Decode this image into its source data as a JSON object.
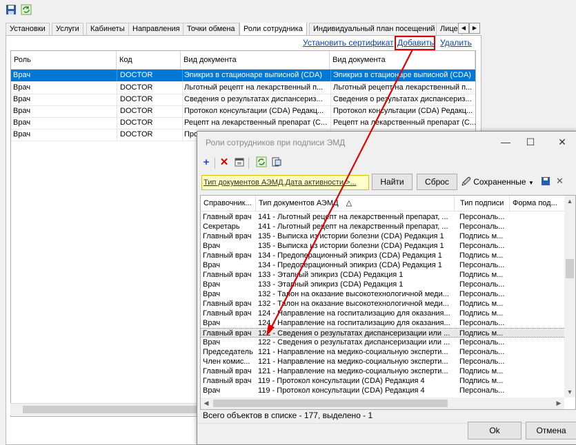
{
  "toolbar": {
    "save_icon": "save-icon",
    "refresh_icon": "refresh-icon"
  },
  "tabs": [
    "Установки",
    "Услуги",
    "Кабинеты",
    "Направления",
    "Точки обмена",
    "Роли сотрудника",
    "Индивидуальный план посещений",
    "Лице"
  ],
  "active_tab_index": 5,
  "actions": {
    "install_cert": "Установить сертификат",
    "add": "Добавить",
    "delete": "Удалить"
  },
  "main_grid": {
    "columns": [
      "Роль",
      "Код",
      "Вид документа",
      "Вид документа"
    ],
    "rows": [
      [
        "Врач",
        "DOCTOR",
        "Эпикриз в стационаре выписной (CDA)",
        "Эпикриз в стационаре выписной (CDA)"
      ],
      [
        "Врач",
        "DOCTOR",
        "Льготный рецепт на лекарственный п...",
        "Льготный рецепт на лекарственный п..."
      ],
      [
        "Врач",
        "DOCTOR",
        "Сведения о результатах диспансериз...",
        "Сведения о результатах диспансериз..."
      ],
      [
        "Врач",
        "DOCTOR",
        "Протокол консультации (CDA) Редакц...",
        "Протокол консультации (CDA) Редакц..."
      ],
      [
        "Врач",
        "DOCTOR",
        "Рецепт на лекарственный препарат (С...",
        "Рецепт на лекарственный препарат (С..."
      ],
      [
        "Врач",
        "DOCTOR",
        "Про",
        ""
      ]
    ],
    "selected_row": 0
  },
  "dialog": {
    "title": "Роли сотрудников при подписи ЭМД",
    "window_controls": {
      "minimize": "—",
      "maximize": "☐",
      "close": "✕"
    },
    "tool_icons": [
      "add-icon",
      "delete-icon",
      "properties-icon",
      "refresh-icon",
      "export-icon"
    ],
    "filter_text": "Тип документов АЭМД.Дата активности >...",
    "find_label": "Найти",
    "reset_label": "Сброс",
    "saved_label": "Сохраненные",
    "columns": [
      "Справочник...",
      "Тип документов АЭМД",
      "Тип подписи",
      "Форма под..."
    ],
    "sort_indicator": "△",
    "rows": [
      [
        "Главный врач",
        "141 - Льготный рецепт на лекарственный препарат, ...",
        "Персональ..."
      ],
      [
        "Секретарь",
        "141 - Льготный рецепт на лекарственный препарат, ...",
        "Персональ..."
      ],
      [
        "Главный врач",
        "135 - Выписка из истории болезни (CDA) Редакция 1",
        "Подпись м..."
      ],
      [
        "Врач",
        "135 - Выписка из истории болезни (CDA) Редакция 1",
        "Персональ..."
      ],
      [
        "Главный врач",
        "134 - Предоперационный эпикриз (CDA) Редакция 1",
        "Подпись м..."
      ],
      [
        "Врач",
        "134 - Предоперационный эпикриз (CDA) Редакция 1",
        "Персональ..."
      ],
      [
        "Главный врач",
        "133 - Этапный эпикриз (CDA) Редакция 1",
        "Подпись м..."
      ],
      [
        "Врач",
        "133 - Этапный эпикриз (CDA) Редакция 1",
        "Персональ..."
      ],
      [
        "Врач",
        "132 - Талон на оказание высокотехнологичной меди...",
        "Персональ..."
      ],
      [
        "Главный врач",
        "132 - Талон на оказание высокотехнологичной меди...",
        "Подпись м..."
      ],
      [
        "Главный врач",
        "124 - Направление на госпитализацию для оказания...",
        "Подпись м..."
      ],
      [
        "Врач",
        "124 - Направление на госпитализацию для оказания...",
        "Персональ..."
      ],
      [
        "Главный врач",
        "122 - Сведения о результатах диспансеризации или ...",
        "Подпись м..."
      ],
      [
        "Врач",
        "122 - Сведения о результатах диспансеризации или ...",
        "Персональ..."
      ],
      [
        "Председатель",
        "121 - Направление на медико-социальную эксперти...",
        "Персональ..."
      ],
      [
        "Член комис...",
        "121 - Направление на медико-социальную эксперти...",
        "Персональ..."
      ],
      [
        "Главный врач",
        "121 - Направление на медико-социальную эксперти...",
        "Подпись м..."
      ],
      [
        "Главный врач",
        "119 - Протокол консультации (CDA) Редакция 4",
        "Подпись м..."
      ],
      [
        "Врач",
        "119 - Протокол консультации (CDA) Редакция 4",
        "Персональ..."
      ]
    ],
    "selected_row": 12,
    "status": "Всего объектов в списке - 177, выделено - 1",
    "ok_label": "Ok",
    "cancel_label": "Отмена"
  },
  "colors": {
    "selection": "#0078d7",
    "link": "#0645ad",
    "highlight_box": "#e00000",
    "arrow": "#e00000",
    "filter_bg": "#ffffc8"
  }
}
